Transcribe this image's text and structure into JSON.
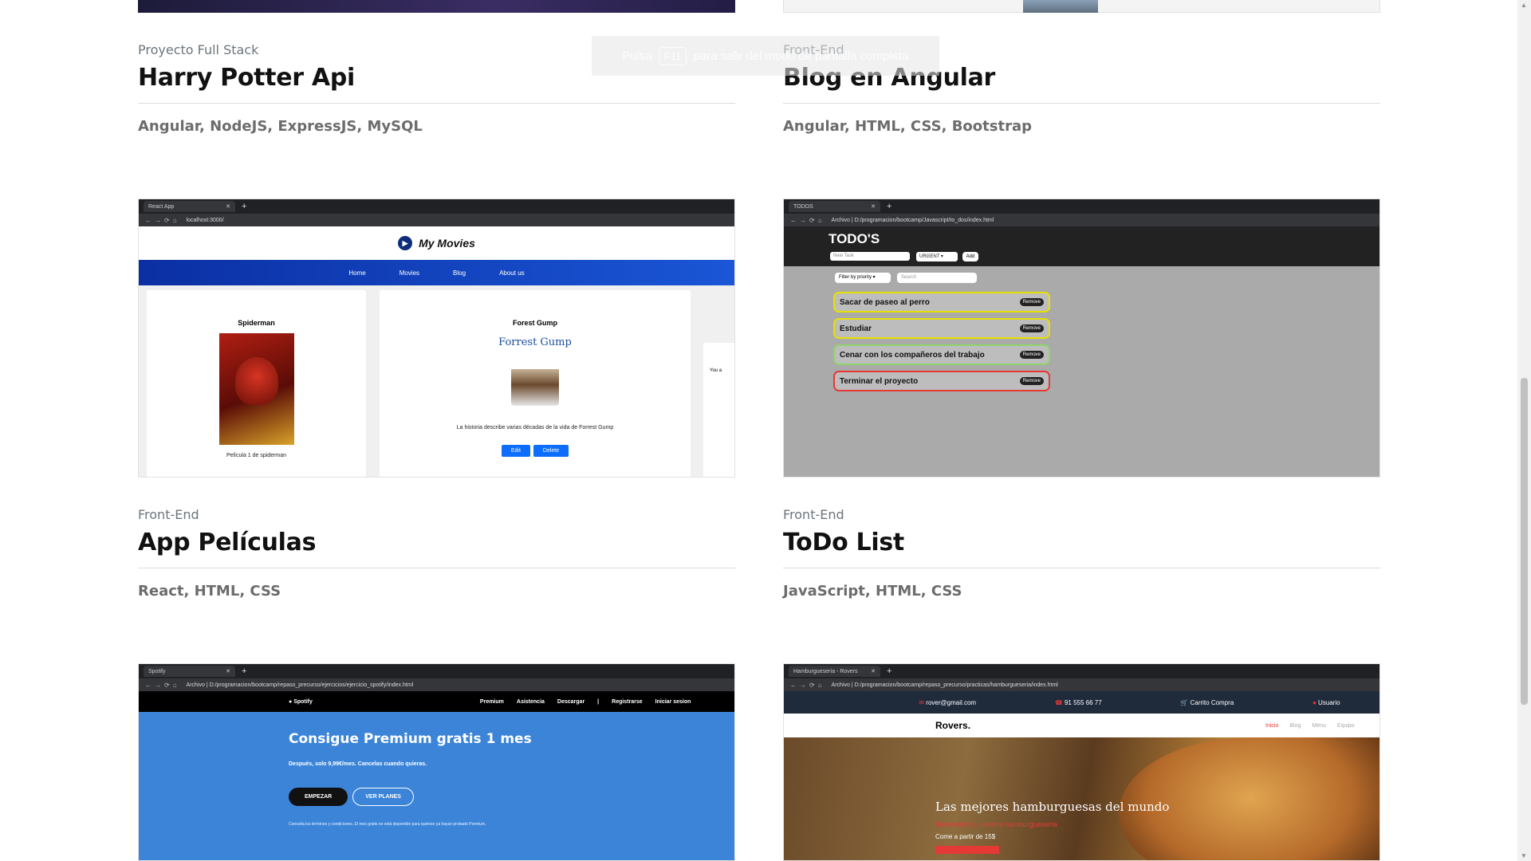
{
  "toast": {
    "pre": "Pulsa",
    "key": "F11",
    "post": "para salir del modo de pantalla completa"
  },
  "projects": [
    {
      "category": "Proyecto Full Stack",
      "title": "Harry Potter Api",
      "tech": "Angular, NodeJS, ExpressJS, MySQL"
    },
    {
      "category": "Front-End",
      "title": "Blog en Angular",
      "tech": "Angular, HTML, CSS, Bootstrap"
    },
    {
      "category": "Front-End",
      "title": "App Películas",
      "tech": "React, HTML, CSS"
    },
    {
      "category": "Front-End",
      "title": "ToDo List",
      "tech": "JavaScript, HTML, CSS"
    }
  ],
  "movies_shot": {
    "tab": "React App",
    "url": "localhost:3000/",
    "brand": "My Movies",
    "nav": [
      "Home",
      "Movies",
      "Blog",
      "About us"
    ],
    "card1_title": "Spiderman",
    "card1_desc": "Película 1 de spiderman",
    "card2_title": "Forest Gump",
    "card2_logo": "Forrest Gump",
    "card2_desc": "La historia describe varias décadas de la vida de Forrest Gump",
    "edit": "Edit",
    "delete": "Delete",
    "side_text": "You a"
  },
  "todo_shot": {
    "tab": "TODOS",
    "url": "Archivo | D:/programacion/bootcamp/Javascript/to_dos/index.html",
    "title": "TODO'S",
    "new_task_placeholder": "New Task",
    "priority": "URGENT",
    "add": "Add",
    "filter": "Filter by priority",
    "search": "Search",
    "remove": "Remove",
    "tasks": [
      {
        "text": "Sacar de paseo al perro",
        "color": "#e6e000"
      },
      {
        "text": "Estudiar",
        "color": "#e6e000"
      },
      {
        "text": "Cenar con los compañeros del trabajo",
        "color": "#8fd46b"
      },
      {
        "text": "Terminar el proyecto",
        "color": "#e53935"
      }
    ]
  },
  "spotify_shot": {
    "tab": "Spotify",
    "url": "Archivo | D:/programacion/bootcamp/repaso_precurso/ejercicios/ejercicio_spotify/index.html",
    "brand": "Spotify",
    "links": [
      "Premium",
      "Asistencia",
      "Descargar",
      "|",
      "Registrarse",
      "Iniciar sesion"
    ],
    "heading": "Consigue Premium gratis 1 mes",
    "sub": "Después, solo 9,99€/mes. Cancelas cuando quieras.",
    "btn1": "EMPEZAR",
    "btn2": "VER PLANES",
    "foot": "Consulta los términos y condiciones. El mes gratis no está disponible para quienes ya hayan probado Premium."
  },
  "rovers_shot": {
    "tab": "Hamburguesería - Rovers",
    "url": "Archivo | D:/programacion/bootcamp/repaso_precurso/practicas/hamburgueseria/index.html",
    "email": "rover@gmail.com",
    "phone": "91 555 66 77",
    "cart": "Carrito Compra",
    "user": "Usuario",
    "brand": "Rovers.",
    "links": [
      "Inicio",
      "Blog",
      "Menu",
      "Equipo"
    ],
    "heading": "Las mejores hamburguesas del mundo",
    "sub1": "Bienvenido a nuestra hamburguesería",
    "sub2": "Come a partir de 15$"
  }
}
